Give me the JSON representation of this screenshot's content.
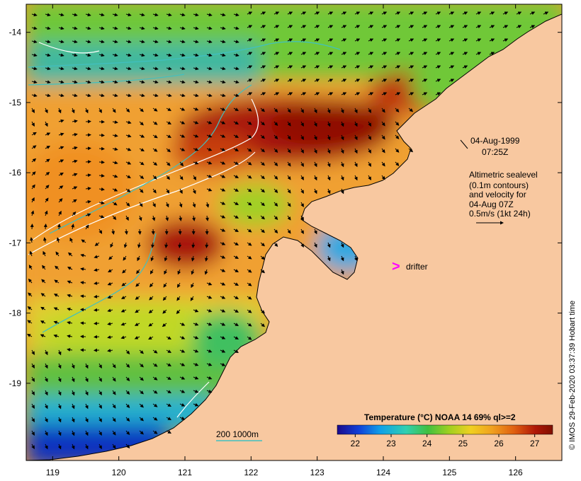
{
  "map": {
    "lon_ticks": [
      "119",
      "120",
      "121",
      "122",
      "123",
      "124",
      "125",
      "126"
    ],
    "lat_ticks": [
      "-14",
      "-15",
      "-16",
      "-17",
      "-18",
      "-19"
    ],
    "lon_range": [
      118.6,
      126.7
    ],
    "lat_range": [
      -20.1,
      -13.6
    ]
  },
  "annotation": {
    "date": "04-Aug-1999",
    "time": "07:25Z",
    "line1": "Altimetric sealevel",
    "line2": "(0.1m contours)",
    "line3": "and velocity for",
    "line4": "04-Aug 07Z",
    "line5": "0.5m/s (1kt 24h)"
  },
  "drifter": {
    "symbol": ">",
    "label": "drifter",
    "color": "#ff00ff"
  },
  "depth_legend": {
    "text": "200  1000m",
    "color": "#40c0c0"
  },
  "colorbar": {
    "title": "Temperature (°C) NOAA 14 69% ql>=2",
    "ticks": [
      "22",
      "23",
      "24",
      "25",
      "26",
      "27"
    ],
    "range": [
      21.5,
      27.5
    ]
  },
  "credit": "© IMOS 29-Feb-2020 03:37:39 Hobart time",
  "colors": {
    "land": "#f8c8a0",
    "sst_scale": [
      "#1a0a8c",
      "#1040d8",
      "#10a0e8",
      "#30d0b0",
      "#40c040",
      "#a0d020",
      "#f0d020",
      "#f0a020",
      "#e06010",
      "#b01808",
      "#801000"
    ]
  }
}
